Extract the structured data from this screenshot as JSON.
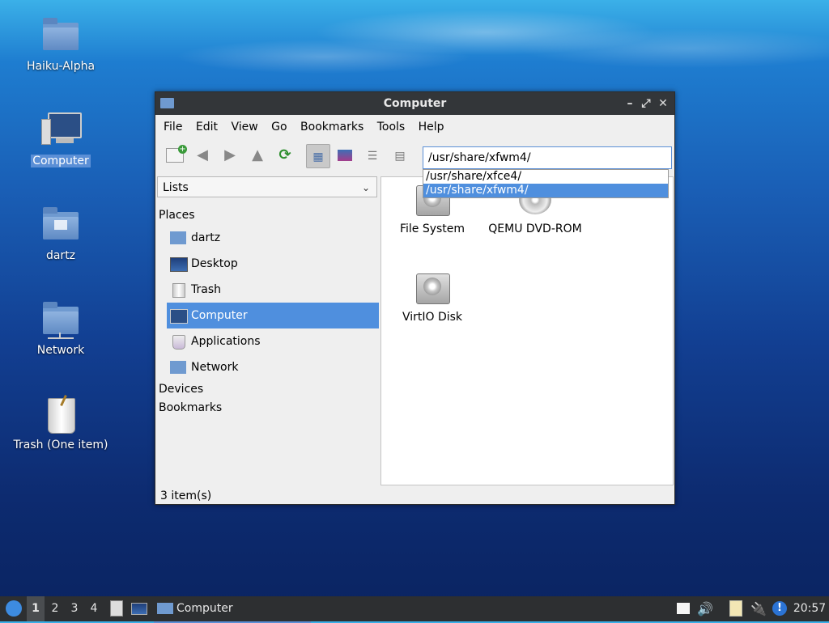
{
  "desktop": {
    "icons": [
      {
        "label": "Haiku-Alpha",
        "icon": "folder-icon"
      },
      {
        "label": "Computer",
        "icon": "computer-icon",
        "selected": true
      },
      {
        "label": "dartz",
        "icon": "home-folder-icon"
      },
      {
        "label": "Network",
        "icon": "network-folder-icon"
      },
      {
        "label": "Trash (One item)",
        "icon": "trash-icon"
      }
    ]
  },
  "window": {
    "title": "Computer",
    "controls": {
      "minimize": "–",
      "maximize": "⤢",
      "close": "✕"
    },
    "menu": [
      "File",
      "Edit",
      "View",
      "Go",
      "Bookmarks",
      "Tools",
      "Help"
    ],
    "address": {
      "value": "/usr/share/xfwm4/"
    },
    "autocomplete": [
      "/usr/share/xfce4/",
      "/usr/share/xfwm4/"
    ],
    "sidebar": {
      "view_select": "Lists",
      "places_header": "Places",
      "places": [
        {
          "label": "dartz",
          "icon": "home-folder-icon"
        },
        {
          "label": "Desktop",
          "icon": "desktop-icon"
        },
        {
          "label": "Trash",
          "icon": "trash-icon"
        },
        {
          "label": "Computer",
          "icon": "computer-icon",
          "selected": true
        },
        {
          "label": "Applications",
          "icon": "applications-icon"
        },
        {
          "label": "Network",
          "icon": "network-folder-icon"
        }
      ],
      "devices_header": "Devices",
      "bookmarks_header": "Bookmarks"
    },
    "items": [
      {
        "label": "File System",
        "icon": "harddisk-icon"
      },
      {
        "label": "QEMU DVD-ROM",
        "icon": "optical-drive-icon"
      },
      {
        "label": "VirtIO Disk",
        "icon": "harddisk-icon"
      }
    ],
    "status": "3 item(s)"
  },
  "taskbar": {
    "workspaces": [
      "1",
      "2",
      "3",
      "4"
    ],
    "task_label": "Computer",
    "clock": "20:57"
  },
  "colors": {
    "selection": "#4f8fde",
    "titlebar": "#333639",
    "taskbar": "#2d2f31"
  }
}
